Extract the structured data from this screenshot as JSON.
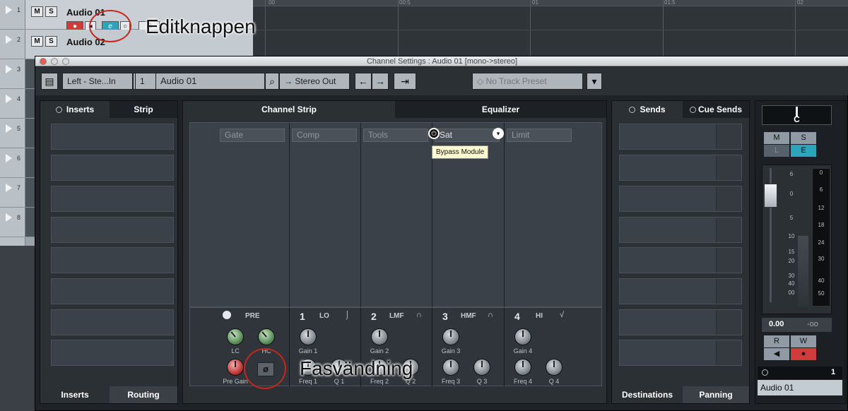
{
  "background_tracks": {
    "rows": [
      {
        "num": "1",
        "name": "Audio 01"
      },
      {
        "num": "2",
        "name": "Audio 02"
      },
      {
        "num": "3",
        "name": ""
      },
      {
        "num": "4",
        "name": ""
      },
      {
        "num": "5",
        "name": ""
      },
      {
        "num": "6",
        "name": ""
      },
      {
        "num": "7",
        "name": ""
      },
      {
        "num": "8",
        "name": ""
      }
    ],
    "m_label": "M",
    "s_label": "S",
    "e_label": "e",
    "ruler_ticks": [
      "00",
      "00:5",
      "01",
      "01:5",
      "02"
    ]
  },
  "annotations": {
    "edit_button": "Editknappen",
    "phase_invert": "Fasvändning"
  },
  "window": {
    "title": "Channel Settings : Audio 01 [mono->stereo]",
    "toolbar": {
      "input_routing": "Left - Ste...In",
      "channel_number": "1",
      "channel_name": "Audio 01",
      "output_routing": "Stereo Out",
      "track_preset": "No Track Preset"
    },
    "left_panel": {
      "tabs": [
        "Inserts",
        "Strip"
      ],
      "bottom_tabs": [
        "Inserts",
        "Routing"
      ]
    },
    "center_panel": {
      "tabs": [
        "Channel Strip",
        "Equalizer"
      ],
      "modules": [
        "Gate",
        "Comp",
        "Tools",
        "Sat",
        "Limit"
      ],
      "tooltip": "Bypass Module",
      "pre": {
        "label": "PRE",
        "knobs": [
          "LC",
          "HC",
          "Pre Gain"
        ]
      },
      "eq_bands": [
        {
          "num": "1",
          "name": "LO",
          "shape": "⌡",
          "gain": "Gain 1",
          "freq": "Freq 1",
          "q": "Q 1"
        },
        {
          "num": "2",
          "name": "LMF",
          "shape": "∩",
          "gain": "Gain 2",
          "freq": "Freq 2",
          "q": "Q 2"
        },
        {
          "num": "3",
          "name": "HMF",
          "shape": "∩",
          "gain": "Gain 3",
          "freq": "Freq 3",
          "q": "Q 3"
        },
        {
          "num": "4",
          "name": "HI",
          "shape": "√",
          "gain": "Gain 4",
          "freq": "Freq 4",
          "q": "Q 4"
        }
      ],
      "phase_symbol": "ø"
    },
    "right_panel": {
      "tabs": [
        "Sends",
        "Cue Sends"
      ],
      "bottom_tabs": [
        "Destinations",
        "Panning"
      ]
    },
    "fader_strip": {
      "pan": "C",
      "buttons": [
        "M",
        "S",
        "L",
        "E",
        "R",
        "W"
      ],
      "scale_left": [
        "6",
        "0",
        "5",
        "10",
        "15",
        "20",
        "30",
        "40",
        "00"
      ],
      "scale_right": [
        "0",
        "6",
        "12",
        "18",
        "24",
        "30",
        "40",
        "50"
      ],
      "volume": "0.00",
      "peak": "-oo",
      "channel_index": "1",
      "channel_name": "Audio 01"
    }
  },
  "colors": {
    "accent_teal": "#2aa5b9",
    "record_red": "#d23b3b",
    "annotation_red": "#c8261b"
  }
}
